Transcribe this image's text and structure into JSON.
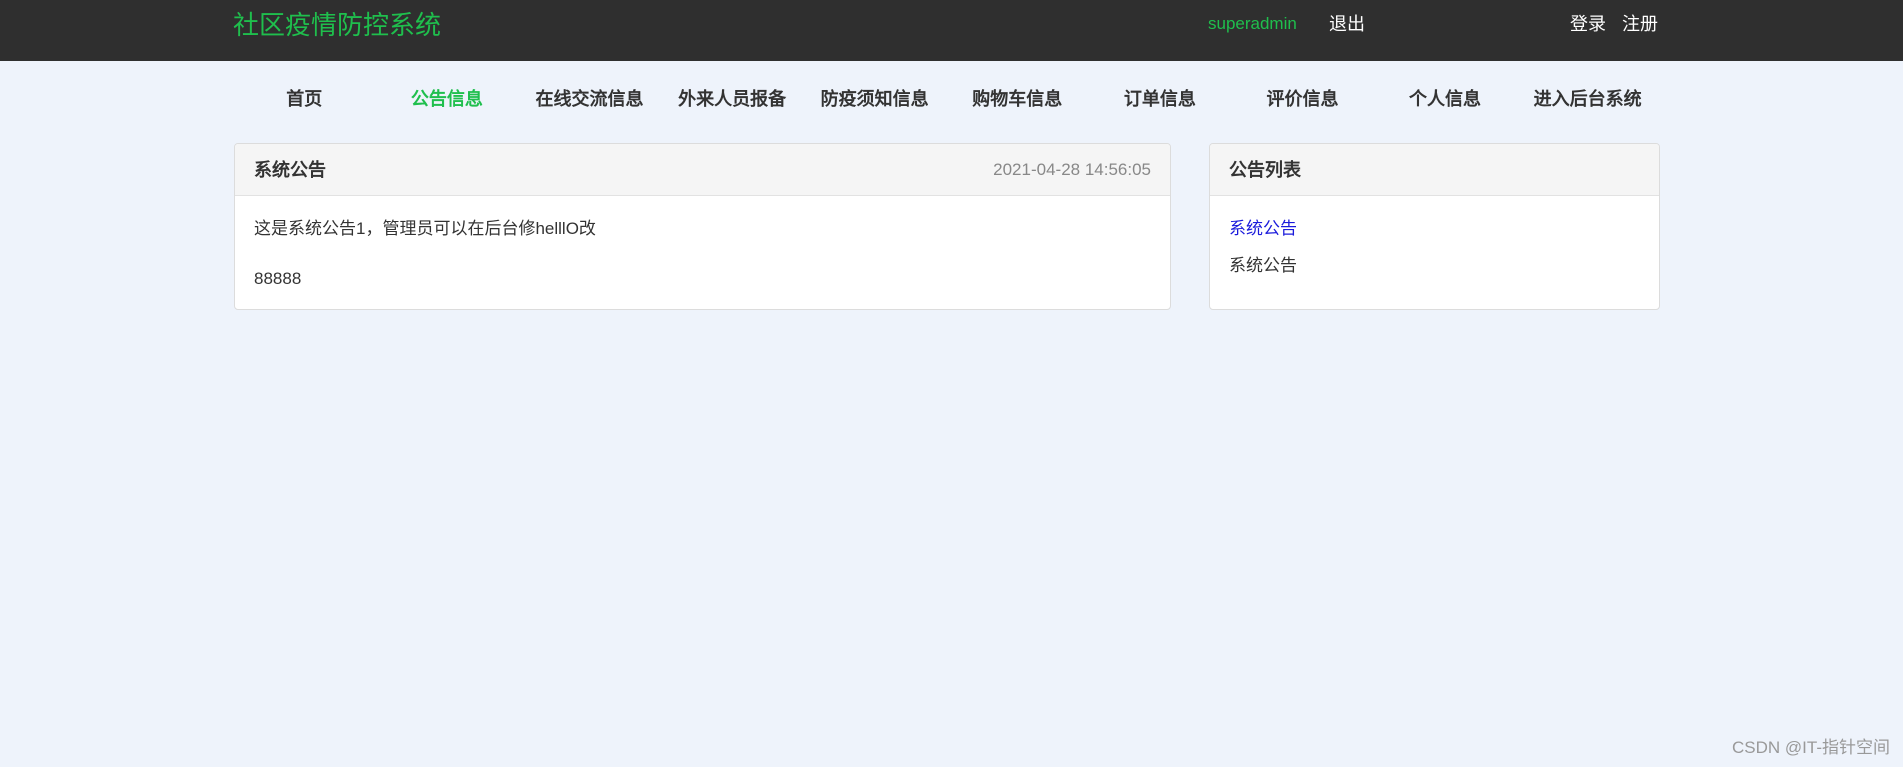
{
  "header": {
    "brand": "社区疫情防控系统",
    "username": "superadmin",
    "logout": "退出",
    "login": "登录",
    "register": "注册"
  },
  "nav": {
    "items": [
      {
        "label": "首页"
      },
      {
        "label": "公告信息"
      },
      {
        "label": "在线交流信息"
      },
      {
        "label": "外来人员报备"
      },
      {
        "label": "防疫须知信息"
      },
      {
        "label": "购物车信息"
      },
      {
        "label": "订单信息"
      },
      {
        "label": "评价信息"
      },
      {
        "label": "个人信息"
      },
      {
        "label": "进入后台系统"
      }
    ],
    "active_index": 1
  },
  "announcement": {
    "title": "系统公告",
    "time": "2021-04-28 14:56:05",
    "lines": [
      "这是系统公告1，管理员可以在后台修helllO改",
      "88888"
    ]
  },
  "sidebar": {
    "title": "公告列表",
    "items": [
      {
        "label": "系统公告"
      },
      {
        "label": "系统公告"
      }
    ]
  },
  "watermark": "CSDN @IT-指针空间",
  "colors": {
    "topbar": "#2f2f2f",
    "brand_green": "#1fbf4d",
    "page_bg": "#eef3fb",
    "link_blue": "#1a1adb"
  }
}
